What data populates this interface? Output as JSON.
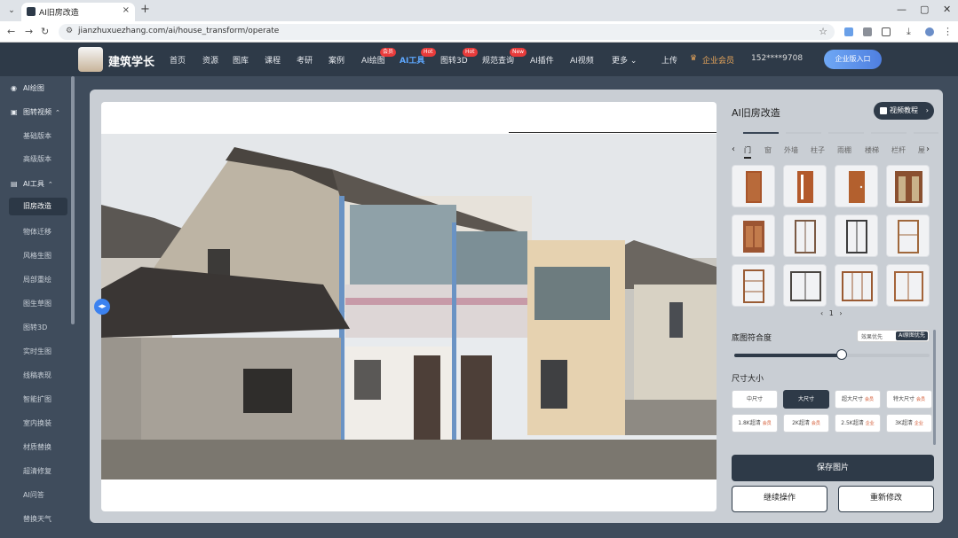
{
  "browser": {
    "tab_title": "AI旧房改造",
    "url": "jianzhuxuezhang.com/ai/house_transform/operate"
  },
  "topnav": {
    "logo_text": "建筑学长",
    "items": [
      {
        "label": "首页"
      },
      {
        "label": "资源"
      },
      {
        "label": "图库"
      },
      {
        "label": "课程"
      },
      {
        "label": "考研"
      },
      {
        "label": "案例"
      },
      {
        "label": "AI绘图",
        "badge": "会员"
      },
      {
        "label": "AI工具",
        "badge": "Hot"
      },
      {
        "label": "图转3D",
        "badge": "Hot"
      },
      {
        "label": "规范查询",
        "badge": "New"
      },
      {
        "label": "AI插件"
      },
      {
        "label": "AI视频"
      },
      {
        "label": "更多"
      }
    ],
    "upload": "上传",
    "vip": "企业会员",
    "phone": "152****9708",
    "enterprise": "企业版入口"
  },
  "sidebar": {
    "sections": [
      {
        "label": "AI绘图"
      },
      {
        "label": "图转视频",
        "children": [
          "基础版本",
          "高级版本"
        ]
      },
      {
        "label": "AI工具",
        "children": [
          "旧房改造",
          "物体迁移",
          "风格生图",
          "局部重绘",
          "图生草图",
          "图转3D",
          "实时生图",
          "线稿表现",
          "智能扩图",
          "室内换装",
          "材质替换",
          "超清修复",
          "AI问答",
          "替换天气"
        ]
      }
    ],
    "selected": "旧房改造"
  },
  "panel": {
    "title": "AI旧房改造",
    "tutorial": "视频教程",
    "categories": [
      "门",
      "窗",
      "外墙",
      "柱子",
      "雨棚",
      "楼梯",
      "栏杆",
      "屋"
    ],
    "selected_category": "门",
    "page": "1",
    "fit_label": "底图符合度",
    "fit_options": [
      "效果优先",
      "AI原图优先"
    ],
    "fit_value": 0.55,
    "size_label": "尺寸大小",
    "sizes": [
      {
        "label": "中尺寸",
        "tag": ""
      },
      {
        "label": "大尺寸",
        "tag": ""
      },
      {
        "label": "超大尺寸",
        "tag": "会员"
      },
      {
        "label": "特大尺寸",
        "tag": "会员"
      },
      {
        "label": "1.8K超清",
        "tag": "会员"
      },
      {
        "label": "2K超清",
        "tag": "会员"
      },
      {
        "label": "2.5K超清",
        "tag": "企业"
      },
      {
        "label": "3K超清",
        "tag": "企业"
      }
    ],
    "selected_size": "大尺寸",
    "save": "保存图片",
    "continue": "继续操作",
    "redo": "重新修改"
  }
}
